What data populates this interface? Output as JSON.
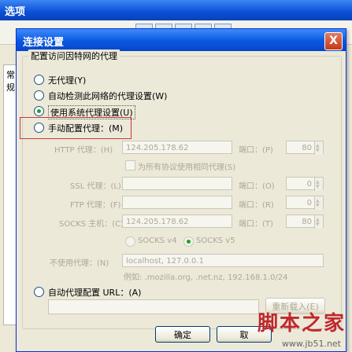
{
  "background_window": {
    "title": "选项",
    "panel_tab": "常规"
  },
  "dialog": {
    "title": "连接设置",
    "close_symbol": "X",
    "group_label": "配置访问因特网的代理",
    "options": {
      "no_proxy": "无代理(Y)",
      "auto_detect": "自动检测此网络的代理设置(W)",
      "system_proxy": "使用系统代理设置(U)",
      "manual_proxy": "手动配置代理：(M)",
      "auto_config": "自动代理配置 URL：(A)"
    },
    "selected_option": "system_proxy",
    "fields": {
      "http_label": "HTTP 代理：(H)",
      "http_value": "124.205.178.62",
      "port_label": "端口：(P)",
      "http_port": "80",
      "same_proxy_label": "为所有协议使用相同代理(S)",
      "ssl_label": "SSL 代理：(L)",
      "ssl_value": "",
      "ssl_port_label": "端口：(O)",
      "ssl_port": "0",
      "ftp_label": "FTP 代理：(F)",
      "ftp_value": "",
      "ftp_port_label": "端口：(R)",
      "ftp_port": "0",
      "socks_label": "SOCKS 主机：(C)",
      "socks_value": "124.205.178.62",
      "socks_port_label": "端口：(T)",
      "socks_port": "80",
      "socks_v4": "SOCKS v4",
      "socks_v5": "SOCKS v5",
      "noproxy_label": "不使用代理：(N)",
      "noproxy_value": "localhost, 127.0.0.1",
      "example_text": "例如: .mozilla.org, .net.nz, 192.168.1.0/24",
      "autoconfig_value": "",
      "reload_label": "重新载入(E)"
    },
    "buttons": {
      "ok": "确定",
      "cancel": "取"
    }
  },
  "watermark": {
    "title": "脚本之家",
    "url": "www.jb51.net"
  },
  "colors": {
    "title_bar": "#0a57e0",
    "highlight_box": "#c43a3a",
    "watermark": "#c0282d"
  }
}
